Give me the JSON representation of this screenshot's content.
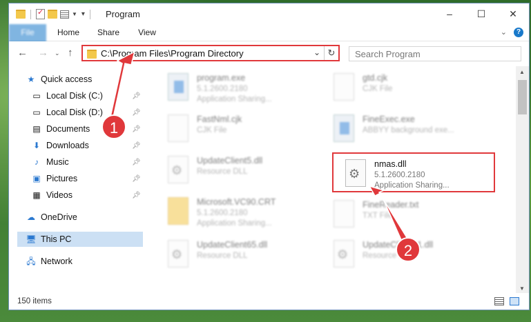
{
  "window": {
    "title": "Program",
    "controls": {
      "minimize": "–",
      "maximize": "☐",
      "close": "✕"
    }
  },
  "ribbon": {
    "tabs": [
      "File",
      "Home",
      "Share",
      "View"
    ],
    "expand_icon": "chevron-down-icon",
    "help_icon": "?"
  },
  "address": {
    "path": "C:\\Program Files\\Program Directory",
    "search_placeholder": "Search Program"
  },
  "nav_pane": {
    "quick_access": "Quick access",
    "items": [
      {
        "label": "Local Disk (C:)",
        "icon": "drive-icon"
      },
      {
        "label": "Local Disk (D:)",
        "icon": "drive-icon"
      },
      {
        "label": "Documents",
        "icon": "documents-icon"
      },
      {
        "label": "Downloads",
        "icon": "downloads-icon"
      },
      {
        "label": "Music",
        "icon": "music-icon"
      },
      {
        "label": "Pictures",
        "icon": "pictures-icon"
      },
      {
        "label": "Videos",
        "icon": "videos-icon"
      }
    ],
    "onedrive": "OneDrive",
    "this_pc": "This PC",
    "network": "Network"
  },
  "files": [
    {
      "name": "program.exe",
      "line1": "5.1.2600.2180",
      "line2": "Application Sharing..."
    },
    {
      "name": "gtd.cjk",
      "line1": "CJK File",
      "line2": ""
    },
    {
      "name": "FastNml.cjk",
      "line1": "CJK File",
      "line2": ""
    },
    {
      "name": "FineExec.exe",
      "line1": "ABBYY background exe...",
      "line2": ""
    },
    {
      "name": "UpdateClient5.dll",
      "line1": "Resource DLL",
      "line2": ""
    },
    {
      "name": "nmas.dll",
      "line1": "5.1.2600.2180",
      "line2": "Application Sharing..."
    },
    {
      "name": "Microsoft.VC90.CRT",
      "line1": "5.1.2600.2180",
      "line2": "Application Sharing..."
    },
    {
      "name": "FineReader.txt",
      "line1": "TXT File",
      "line2": ""
    },
    {
      "name": "UpdateClient65.dll",
      "line1": "Resource DLL",
      "line2": ""
    },
    {
      "name": "UpdateClient01.dll",
      "line1": "Resource DLL",
      "line2": ""
    }
  ],
  "status": {
    "count": "150 items"
  },
  "annotations": {
    "step1": "1",
    "step2": "2",
    "accent": "#e0383b"
  }
}
